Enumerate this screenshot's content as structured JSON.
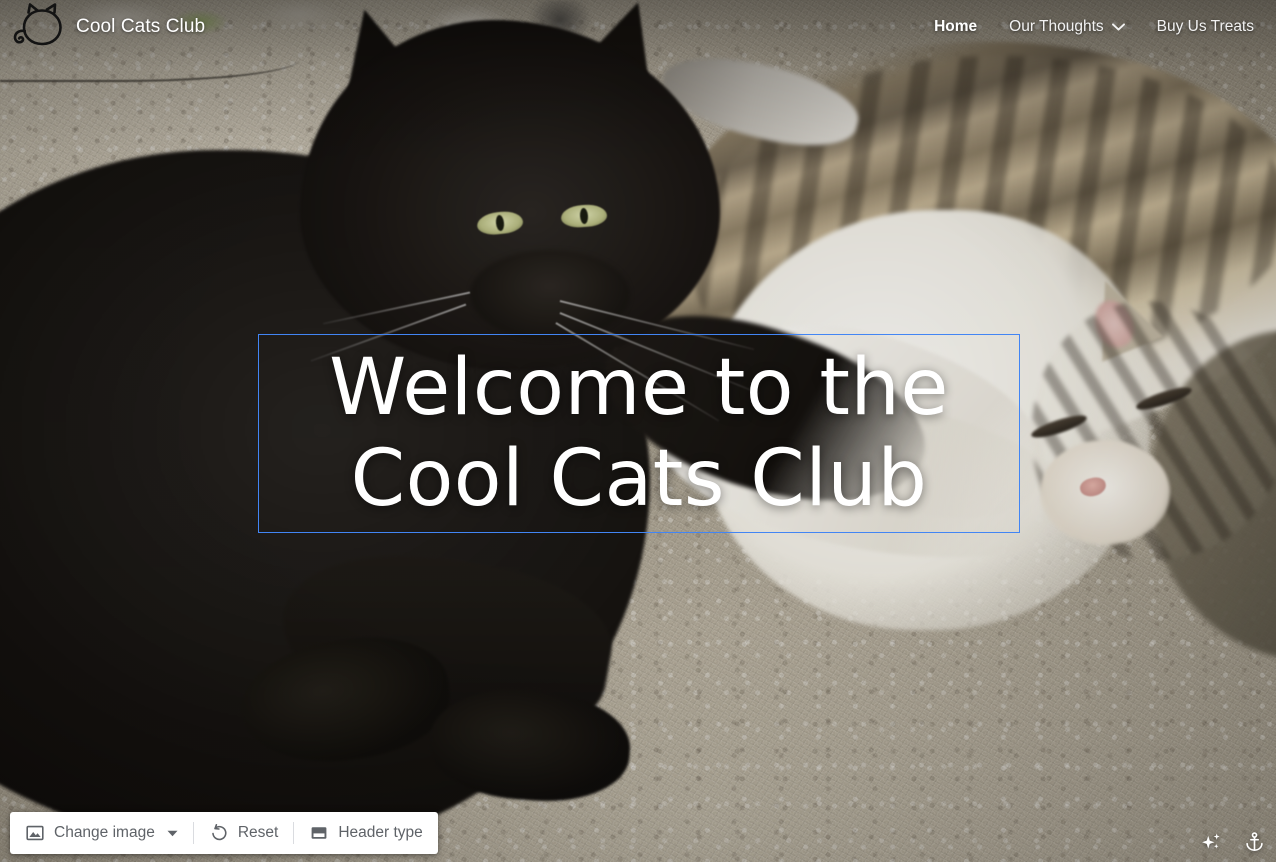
{
  "site": {
    "brand_name": "Cool Cats Club",
    "logo_icon": "cat-head-icon"
  },
  "nav": {
    "items": [
      {
        "label": "Home",
        "active": true,
        "has_dropdown": false
      },
      {
        "label": "Our Thoughts",
        "active": false,
        "has_dropdown": true,
        "dropdown_icon": "chevron-down-icon"
      },
      {
        "label": "Buy Us Treats",
        "active": false,
        "has_dropdown": false
      }
    ]
  },
  "hero": {
    "heading": "Welcome to the\nCool Cats Club",
    "selection_color": "#4285f4",
    "background_description": "photo of three cats lying on a light carpet"
  },
  "toolbar": {
    "change_image_label": "Change image",
    "change_image_icon": "image-icon",
    "change_image_caret_icon": "caret-down-icon",
    "reset_label": "Reset",
    "reset_icon": "rotate-counterclockwise-icon",
    "header_type_label": "Header type",
    "header_type_icon": "header-layout-icon",
    "text_color": "#5f6368",
    "background_color": "#ffffff"
  },
  "corner_tools": {
    "items": [
      {
        "name": "sparkles-icon"
      },
      {
        "name": "anchor-icon"
      }
    ]
  }
}
